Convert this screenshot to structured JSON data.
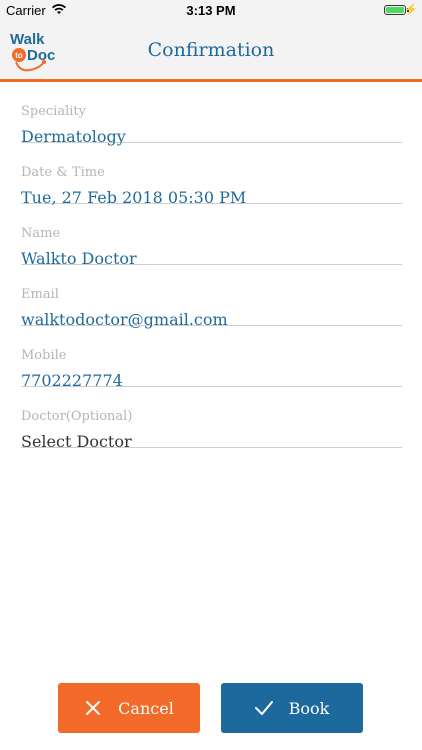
{
  "status_bar": {
    "carrier": "Carrier",
    "time": "3:13 PM"
  },
  "header": {
    "logo": {
      "line1": "Walk",
      "line2_small": "to",
      "line2": "Doc"
    },
    "title": "Confirmation"
  },
  "form": {
    "fields": [
      {
        "label": "Speciality",
        "value": "Dermatology"
      },
      {
        "label": "Date & Time",
        "value": "Tue, 27 Feb 2018 05:30 PM"
      },
      {
        "label": "Name",
        "value": "Walkto Doctor"
      },
      {
        "label": "Email",
        "value": "walktodoctor@gmail.com"
      },
      {
        "label": "Mobile",
        "value": "7702227774"
      },
      {
        "label": "Doctor(Optional)",
        "value": "Select Doctor"
      }
    ]
  },
  "actions": {
    "cancel_label": "Cancel",
    "book_label": "Book"
  },
  "colors": {
    "accent_orange": "#f26b2a",
    "primary_blue": "#1f6a9a"
  }
}
